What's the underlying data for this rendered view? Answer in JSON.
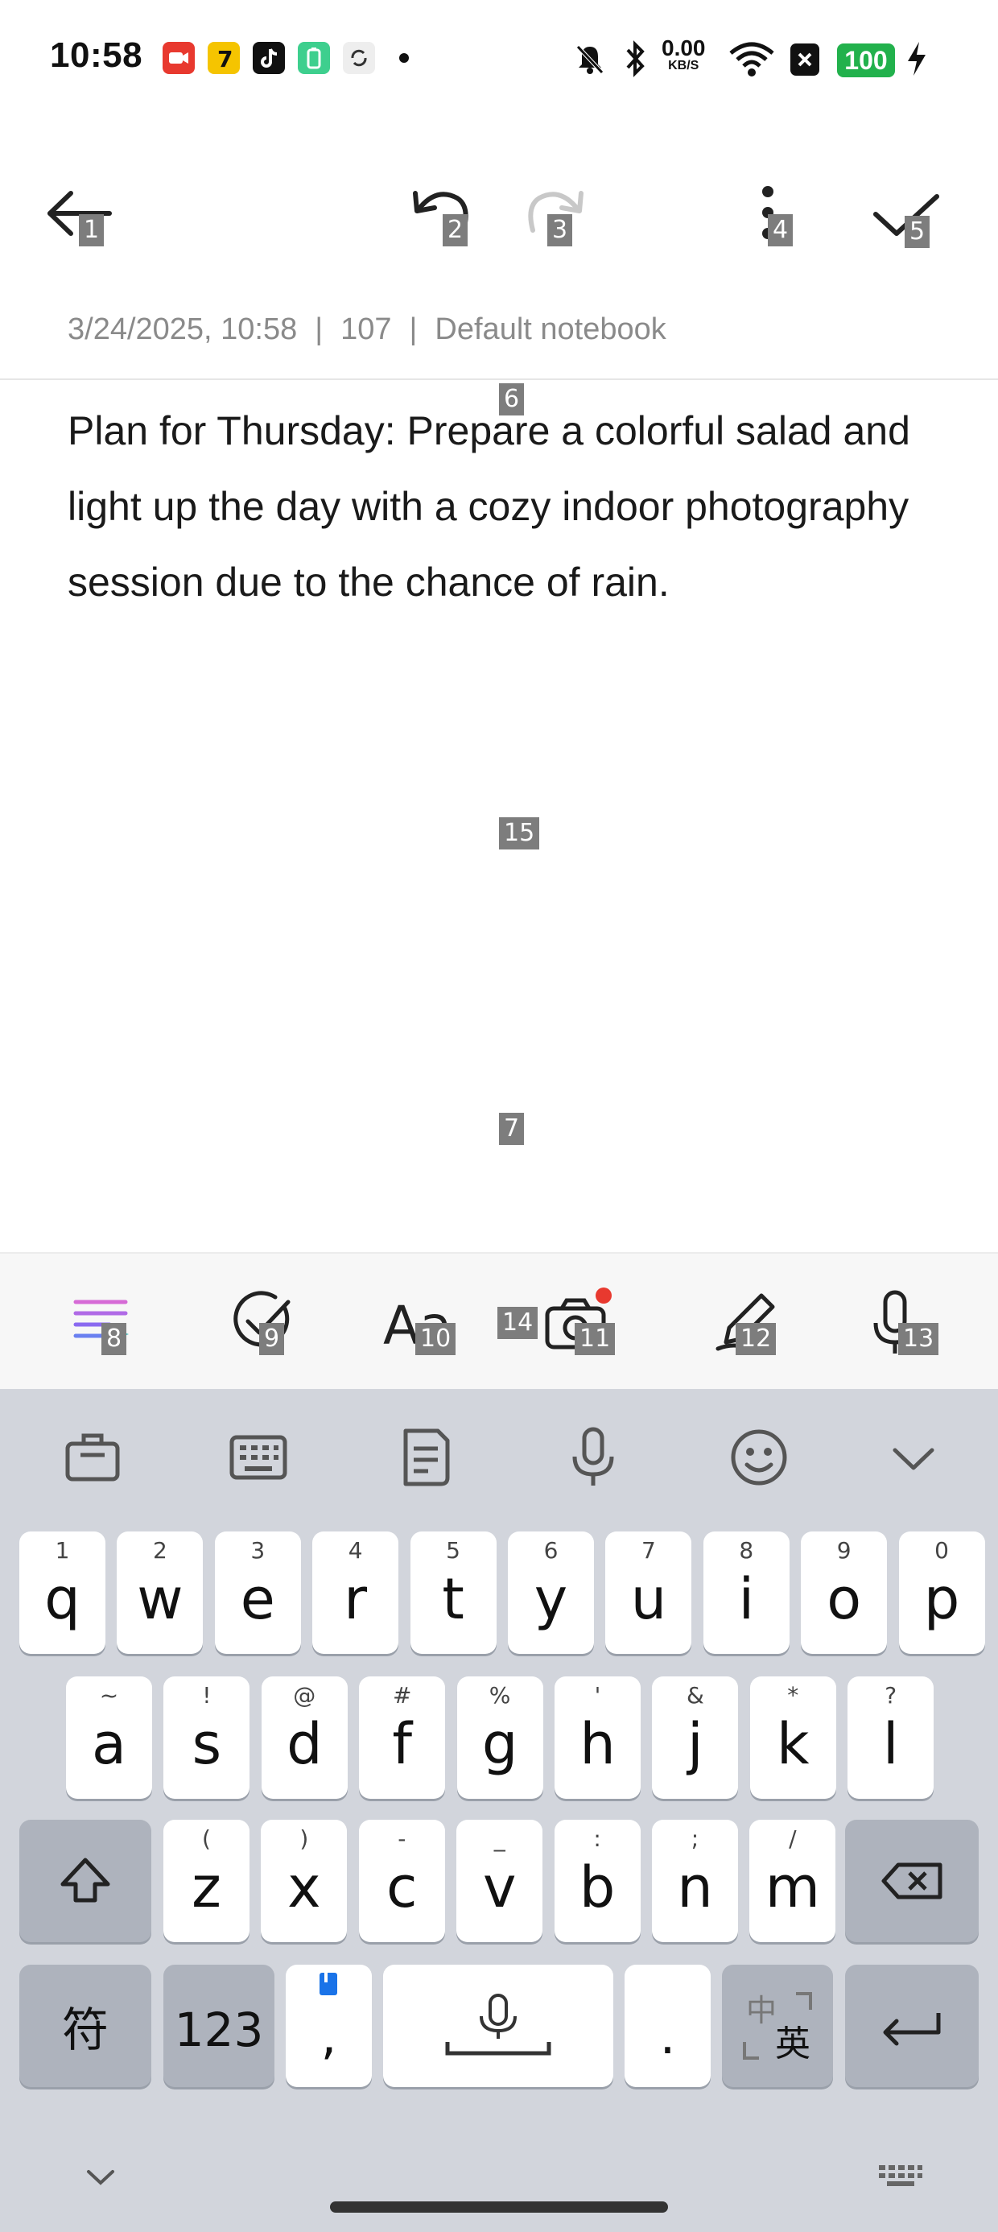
{
  "status_bar": {
    "time": "10:58",
    "net_speed_value": "0.00",
    "net_speed_unit": "KB/S",
    "battery": "100",
    "app_icons": [
      "video-call-icon",
      "app-7-icon",
      "tiktok-icon",
      "battery-app-icon",
      "sync-app-icon"
    ],
    "right_icons": [
      "mute-icon",
      "bluetooth-icon",
      "wifi-icon",
      "close-box-icon",
      "charging-icon"
    ]
  },
  "toolbar": {
    "back_label": "1",
    "undo_label": "2",
    "redo_label": "3",
    "more_label": "4",
    "done_label": "5"
  },
  "meta": {
    "datetime": "3/24/2025, 10:58",
    "char_count": "107",
    "notebook": "Default notebook",
    "separator": "|",
    "tag": "6"
  },
  "note": {
    "text": "Plan for Thursday: Prepare a colorful salad and light up the day with a cozy indoor photography session due to the chance of rain.",
    "tag_area": "15",
    "tag_lower": "7"
  },
  "format_bar": {
    "ai_label": "8",
    "checklist_label": "9",
    "text_style_label": "10",
    "camera_label": "11",
    "image_label": "14",
    "pen_label": "12",
    "voice_label": "13"
  },
  "keyboard": {
    "row1": [
      {
        "k": "q",
        "h": "1"
      },
      {
        "k": "w",
        "h": "2"
      },
      {
        "k": "e",
        "h": "3"
      },
      {
        "k": "r",
        "h": "4"
      },
      {
        "k": "t",
        "h": "5"
      },
      {
        "k": "y",
        "h": "6"
      },
      {
        "k": "u",
        "h": "7"
      },
      {
        "k": "i",
        "h": "8"
      },
      {
        "k": "o",
        "h": "9"
      },
      {
        "k": "p",
        "h": "0"
      }
    ],
    "row2": [
      {
        "k": "a",
        "h": "~"
      },
      {
        "k": "s",
        "h": "!"
      },
      {
        "k": "d",
        "h": "@"
      },
      {
        "k": "f",
        "h": "#"
      },
      {
        "k": "g",
        "h": "%"
      },
      {
        "k": "h",
        "h": "'"
      },
      {
        "k": "j",
        "h": "&"
      },
      {
        "k": "k",
        "h": "*"
      },
      {
        "k": "l",
        "h": "?"
      }
    ],
    "row3": [
      {
        "k": "z",
        "h": "("
      },
      {
        "k": "x",
        "h": ")"
      },
      {
        "k": "c",
        "h": "-"
      },
      {
        "k": "v",
        "h": "_"
      },
      {
        "k": "b",
        "h": ":"
      },
      {
        "k": "n",
        "h": ";"
      },
      {
        "k": "m",
        "h": "/"
      }
    ],
    "symbol_key": "符",
    "numbers_key": "123",
    "comma_key": ",",
    "period_key": ".",
    "lang_key_top": "中",
    "lang_key_bottom": "英"
  }
}
